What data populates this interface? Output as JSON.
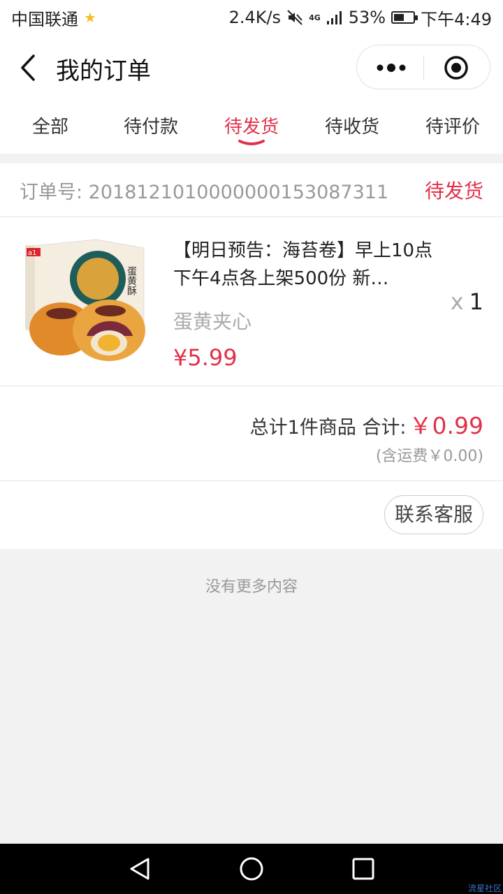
{
  "status_bar": {
    "carrier": "中国联通",
    "speed": "2.4K/s",
    "network": "4G",
    "battery": "53%",
    "battery_level": 0.53,
    "time": "下午4:49"
  },
  "header": {
    "title": "我的订单"
  },
  "tabs": [
    {
      "label": "全部",
      "active": false
    },
    {
      "label": "待付款",
      "active": false
    },
    {
      "label": "待发货",
      "active": true
    },
    {
      "label": "待收货",
      "active": false
    },
    {
      "label": "待评价",
      "active": false
    }
  ],
  "order": {
    "number_label": "订单号: 2018121010000000153087311",
    "status": "待发货",
    "product": {
      "title": "【明日预告：海苔卷】早上10点下午4点各上架500份 新…",
      "spec": "蛋黄夹心",
      "price": "¥5.99",
      "qty_prefix": "x",
      "qty": "1",
      "image_text": {
        "brand": "a1",
        "name": "蛋黄酥"
      }
    },
    "summary": {
      "label": "总计1件商品 合计:",
      "total": "￥0.99",
      "shipping": "(含运费￥0.00)"
    },
    "contact_label": "联系客服"
  },
  "footer_text": "没有更多内容",
  "watermark": "流星社区",
  "colors": {
    "accent": "#e2304a",
    "muted": "#999999",
    "background": "#f2f2f2"
  }
}
